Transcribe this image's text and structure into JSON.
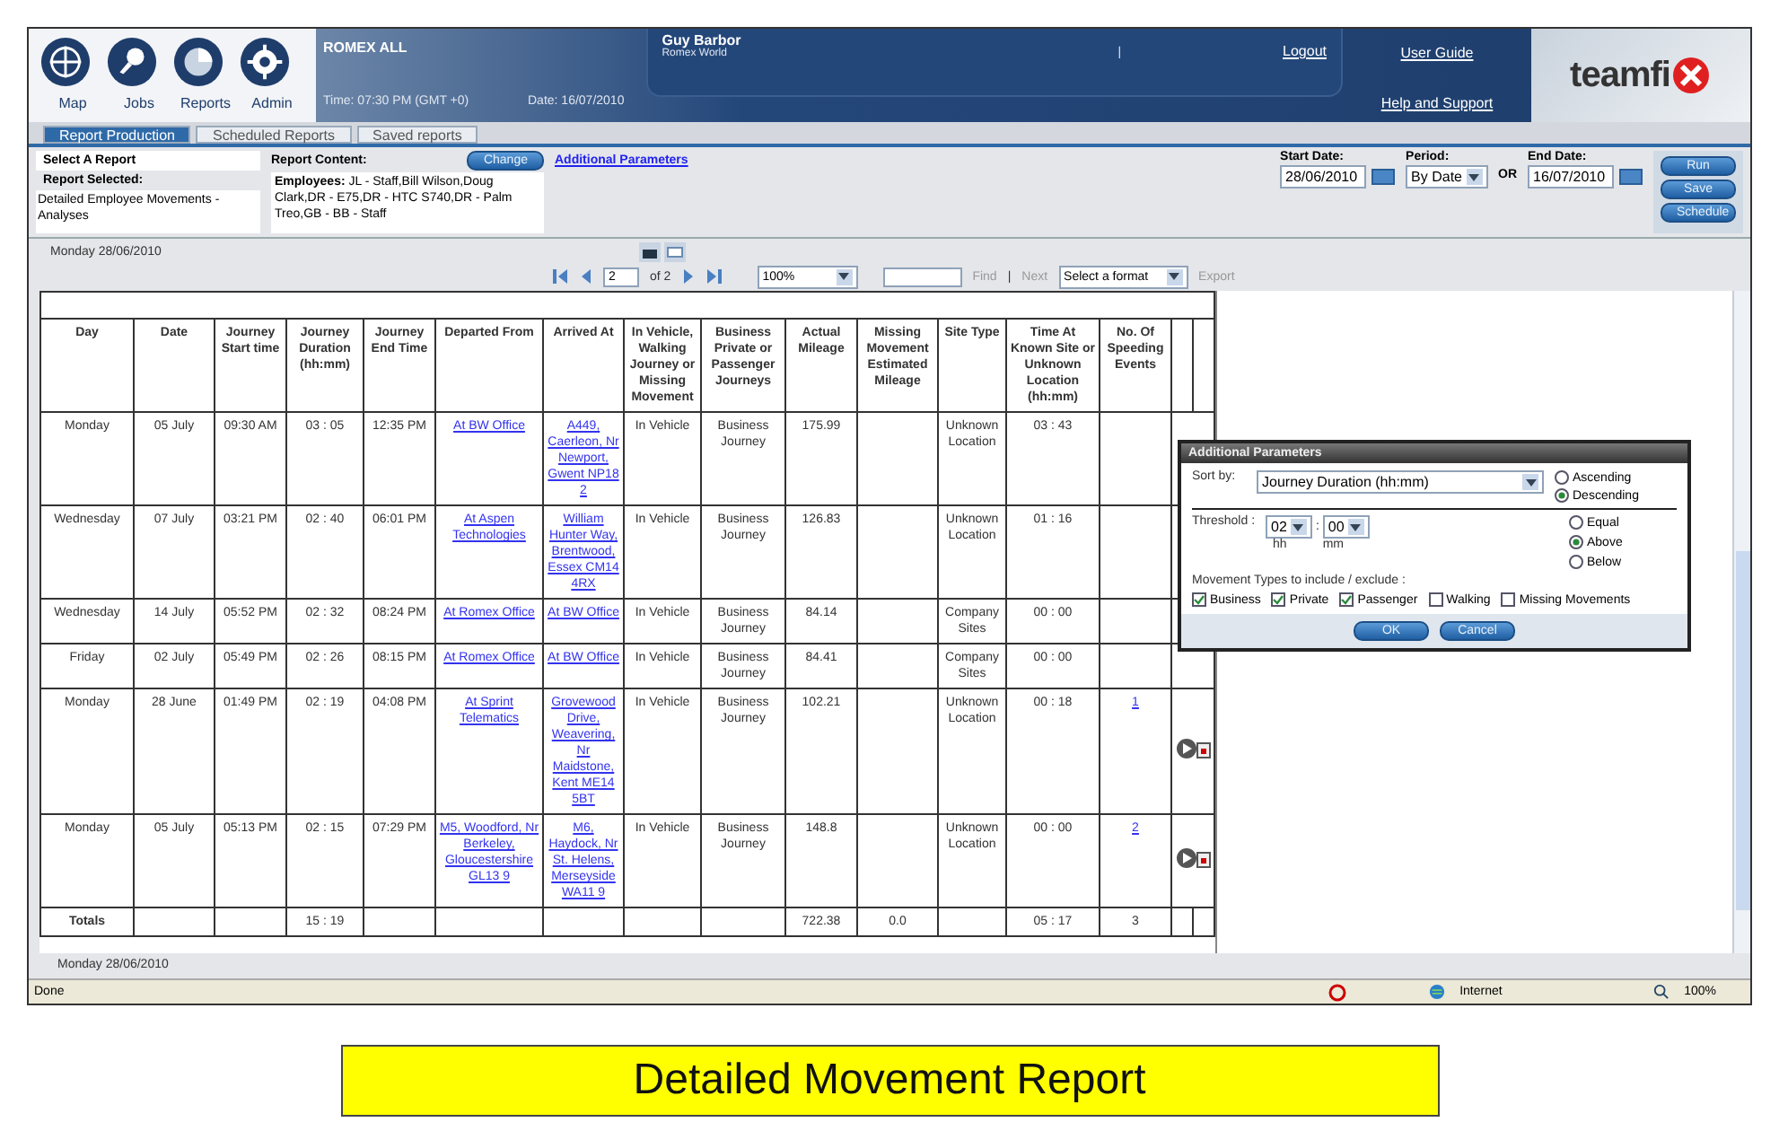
{
  "nav": [
    {
      "label": "Map"
    },
    {
      "label": "Jobs"
    },
    {
      "label": "Reports"
    },
    {
      "label": "Admin"
    }
  ],
  "banner": {
    "company": "ROMEX ALL",
    "time": "Time: 07:30 PM (GMT +0)",
    "date": "Date: 16/07/2010",
    "user": "Guy Barbor",
    "org": "Romex World",
    "separator": "|",
    "logout": "Logout",
    "links": [
      "User Guide",
      "Help and Support"
    ],
    "logo": "teamfi"
  },
  "tabs": [
    {
      "label": "Report Production",
      "selected": true
    },
    {
      "label": "Scheduled Reports",
      "selected": false
    },
    {
      "label": "Saved reports",
      "selected": false
    }
  ],
  "report": {
    "select_label": "Select A Report",
    "selected_label": "Report Selected:",
    "selected_value": "Detailed Employee Movements - Analyses",
    "content_label": "Report Content:",
    "content_text": "**Employees:** JL - Staff,Bill Wilson,Doug Clark,DR - E75,DR - HTC S740,DR - Palm Treo,GB - BB - Staff",
    "change": "Change",
    "additional": "Additional Parameters"
  },
  "dates": {
    "start_label": "Start Date:",
    "start_value": "28/06/2010",
    "period_label": "Period:",
    "period_value": "By Date",
    "or": "OR",
    "end_label": "End Date:",
    "end_value": "16/07/2010"
  },
  "actions": [
    "Run",
    "Save",
    "Schedule"
  ],
  "report_date": "Monday 28/06/2010",
  "pager": {
    "page": "2",
    "of": "of 2",
    "zoom": "100%",
    "find": "Find",
    "sep": "|",
    "next": "Next",
    "format": "Select a format",
    "export": "Export"
  },
  "table": {
    "columns": [
      "Day",
      "Date",
      "Journey Start time",
      "Journey Duration (hh:mm)",
      "Journey End Time",
      "Departed From",
      "Arrived At",
      "In Vehicle, Walking Journey or Missing Movement",
      "Business Private or Passenger Journeys",
      "Actual Mileage",
      "Missing Movement Estimated Mileage",
      "Site Type",
      "Time At Known Site or Unknown Location (hh:mm)",
      "No. Of Speeding Events"
    ],
    "rows": [
      {
        "day": "Monday",
        "date": "05 July",
        "start": "09:30 AM",
        "duration": "03 : 05",
        "end": "12:35 PM",
        "departed": "At BW Office",
        "arrived": "A449, Caerleon, Nr Newport, Gwent NP18 2",
        "mode": "In Vehicle",
        "journey": "Business Journey",
        "mileage": "175.99",
        "site": "Unknown Location",
        "time_at": "03 : 43",
        "playback": false
      },
      {
        "day": "Wednesday",
        "date": "07 July",
        "start": "03:21 PM",
        "duration": "02 : 40",
        "end": "06:01 PM",
        "departed": "At Aspen Technologies",
        "arrived": "William Hunter Way, Brentwood, Essex CM14 4RX",
        "mode": "In Vehicle",
        "journey": "Business Journey",
        "mileage": "126.83",
        "site": "Unknown Location",
        "time_at": "01 : 16",
        "playback": false
      },
      {
        "day": "Wednesday",
        "date": "14 July",
        "start": "05:52 PM",
        "duration": "02 : 32",
        "end": "08:24 PM",
        "departed": "At Romex Office",
        "arrived": "At BW Office",
        "mode": "In Vehicle",
        "journey": "Business Journey",
        "mileage": "84.14",
        "site": "Company Sites",
        "time_at": "00 : 00",
        "playback": false
      },
      {
        "day": "Friday",
        "date": "02 July",
        "start": "05:49 PM",
        "duration": "02 : 26",
        "end": "08:15 PM",
        "departed": "At Romex Office",
        "arrived": "At BW Office",
        "mode": "In Vehicle",
        "journey": "Business Journey",
        "mileage": "84.41",
        "site": "Company Sites",
        "time_at": "00 : 00",
        "playback": false
      },
      {
        "day": "Monday",
        "date": "28 June",
        "start": "01:49 PM",
        "duration": "02 : 19",
        "end": "04:08 PM",
        "departed": "At Sprint Telematics",
        "arrived": "Grovewood Drive, Weavering, Nr Maidstone, Kent ME14 5BT",
        "mode": "In Vehicle",
        "journey": "Business Journey",
        "mileage": "102.21",
        "site": "Unknown Location",
        "time_at": "00 : 18",
        "speeding": "1",
        "playback": true
      },
      {
        "day": "Monday",
        "date": "05 July",
        "start": "05:13 PM",
        "duration": "02 : 15",
        "end": "07:29 PM",
        "departed": "M5, Woodford, Nr Berkeley, Gloucestershire GL13 9",
        "arrived": "M6, Haydock, Nr St. Helens, Merseyside WA11 9",
        "mode": "In Vehicle",
        "journey": "Business Journey",
        "mileage": "148.8",
        "site": "Unknown Location",
        "time_at": "00 : 00",
        "speeding": "2",
        "playback": true
      }
    ],
    "totals": {
      "label": "Totals",
      "duration": "15 : 19",
      "mileage": "722.38",
      "estimated": "0.0",
      "time_at": "05 : 17",
      "speeding": "3"
    }
  },
  "footer_date": "Monday 28/06/2010",
  "dialog": {
    "title": "Additional Parameters",
    "sort_label": "Sort by:",
    "sort_value": "Journey Duration (hh:mm)",
    "order": [
      {
        "label": "Ascending",
        "selected": false
      },
      {
        "label": "Descending",
        "selected": true
      }
    ],
    "threshold_label": "Threshold :",
    "hours": "02",
    "time_sep": ":",
    "minutes": "00",
    "hh": "hh",
    "mm": "mm",
    "compare": [
      {
        "label": "Equal",
        "selected": false
      },
      {
        "label": "Above",
        "selected": true
      },
      {
        "label": "Below",
        "selected": false
      }
    ],
    "types_label": "Movement Types to include / exclude :",
    "types": [
      {
        "label": "Business",
        "checked": true
      },
      {
        "label": "Private",
        "checked": true
      },
      {
        "label": "Passenger",
        "checked": true
      },
      {
        "label": "Walking",
        "checked": false
      },
      {
        "label": "Missing Movements",
        "checked": false
      }
    ],
    "buttons": [
      "OK",
      "Cancel"
    ]
  },
  "status": {
    "text": "Done",
    "zone": "Internet",
    "zoom": "100%"
  },
  "caption": "Detailed Movement Report"
}
